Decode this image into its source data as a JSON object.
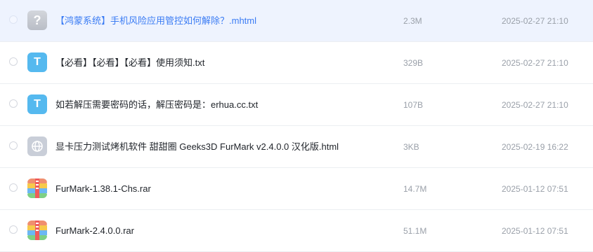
{
  "files": [
    {
      "name": "【鸿蒙系统】手机风险应用管控如何解除？.mhtml",
      "size": "2.3M",
      "date": "2025-02-27 21:10",
      "icon": "unknown-file-icon",
      "glyph": "?"
    },
    {
      "name": "【必看】【必看】【必看】使用须知.txt",
      "size": "329B",
      "date": "2025-02-27 21:10",
      "icon": "text-file-icon",
      "glyph": "T"
    },
    {
      "name": "如若解压需要密码的话，解压密码是：erhua.cc.txt",
      "size": "107B",
      "date": "2025-02-27 21:10",
      "icon": "text-file-icon",
      "glyph": "T"
    },
    {
      "name": "显卡压力测试烤机软件 甜甜圈 Geeks3D FurMark v2.4.0.0 汉化版.html",
      "size": "3KB",
      "date": "2025-02-19 16:22",
      "icon": "web-file-icon"
    },
    {
      "name": "FurMark-1.38.1-Chs.rar",
      "size": "14.7M",
      "date": "2025-01-12 07:51",
      "icon": "archive-file-icon"
    },
    {
      "name": "FurMark-2.4.0.0.rar",
      "size": "51.1M",
      "date": "2025-01-12 07:51",
      "icon": "archive-file-icon"
    }
  ],
  "colors": {
    "selected_row_bg": "#eef3fe",
    "selected_name": "#3b7cf4",
    "txt_icon": "#55b9ef",
    "meta_text": "#9aa0a9"
  }
}
